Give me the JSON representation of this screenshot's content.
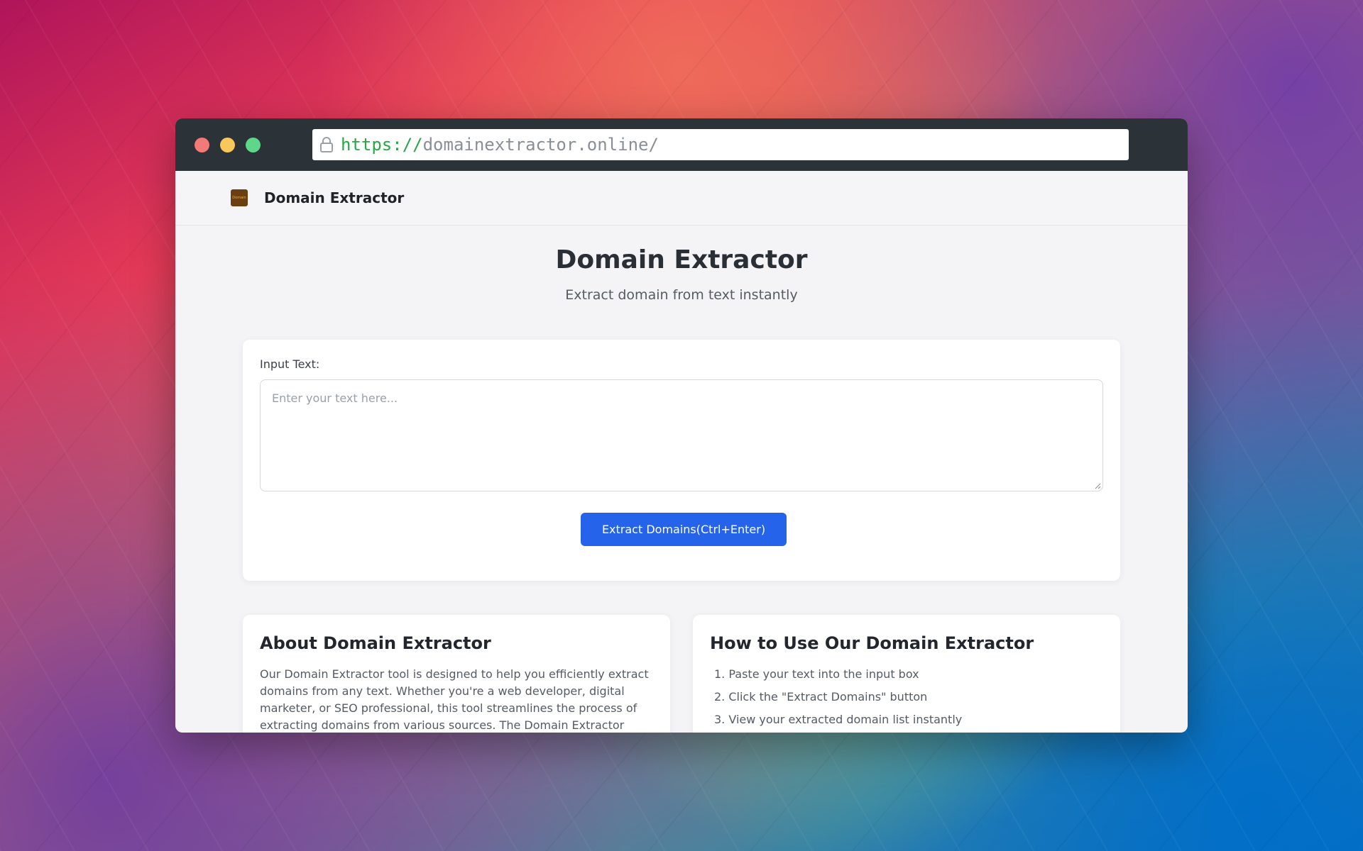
{
  "browser": {
    "url_scheme": "https://",
    "url_host": "domainextractor.online/"
  },
  "header": {
    "logo_text": "Domain",
    "site_name": "Domain Extractor"
  },
  "hero": {
    "title": "Domain Extractor",
    "subtitle": "Extract domain from text instantly"
  },
  "form": {
    "input_label": "Input Text:",
    "placeholder": "Enter your text here...",
    "value": "",
    "button_label": "Extract Domains(Ctrl+Enter)"
  },
  "about": {
    "title": "About Domain Extractor",
    "text": "Our Domain Extractor tool is designed to help you efficiently extract domains from any text. Whether you're a web developer, digital marketer, or SEO professional, this tool streamlines the process of extracting domains from various sources. The Domain Extractor"
  },
  "howto": {
    "title": "How to Use Our Domain Extractor",
    "steps": [
      "1. Paste your text into the input box",
      "2. Click the \"Extract Domains\" button",
      "3. View your extracted domain list instantly"
    ]
  },
  "icons": {
    "lock": "lock-icon"
  },
  "colors": {
    "accent": "#2563eb",
    "url_scheme": "#28a745"
  }
}
